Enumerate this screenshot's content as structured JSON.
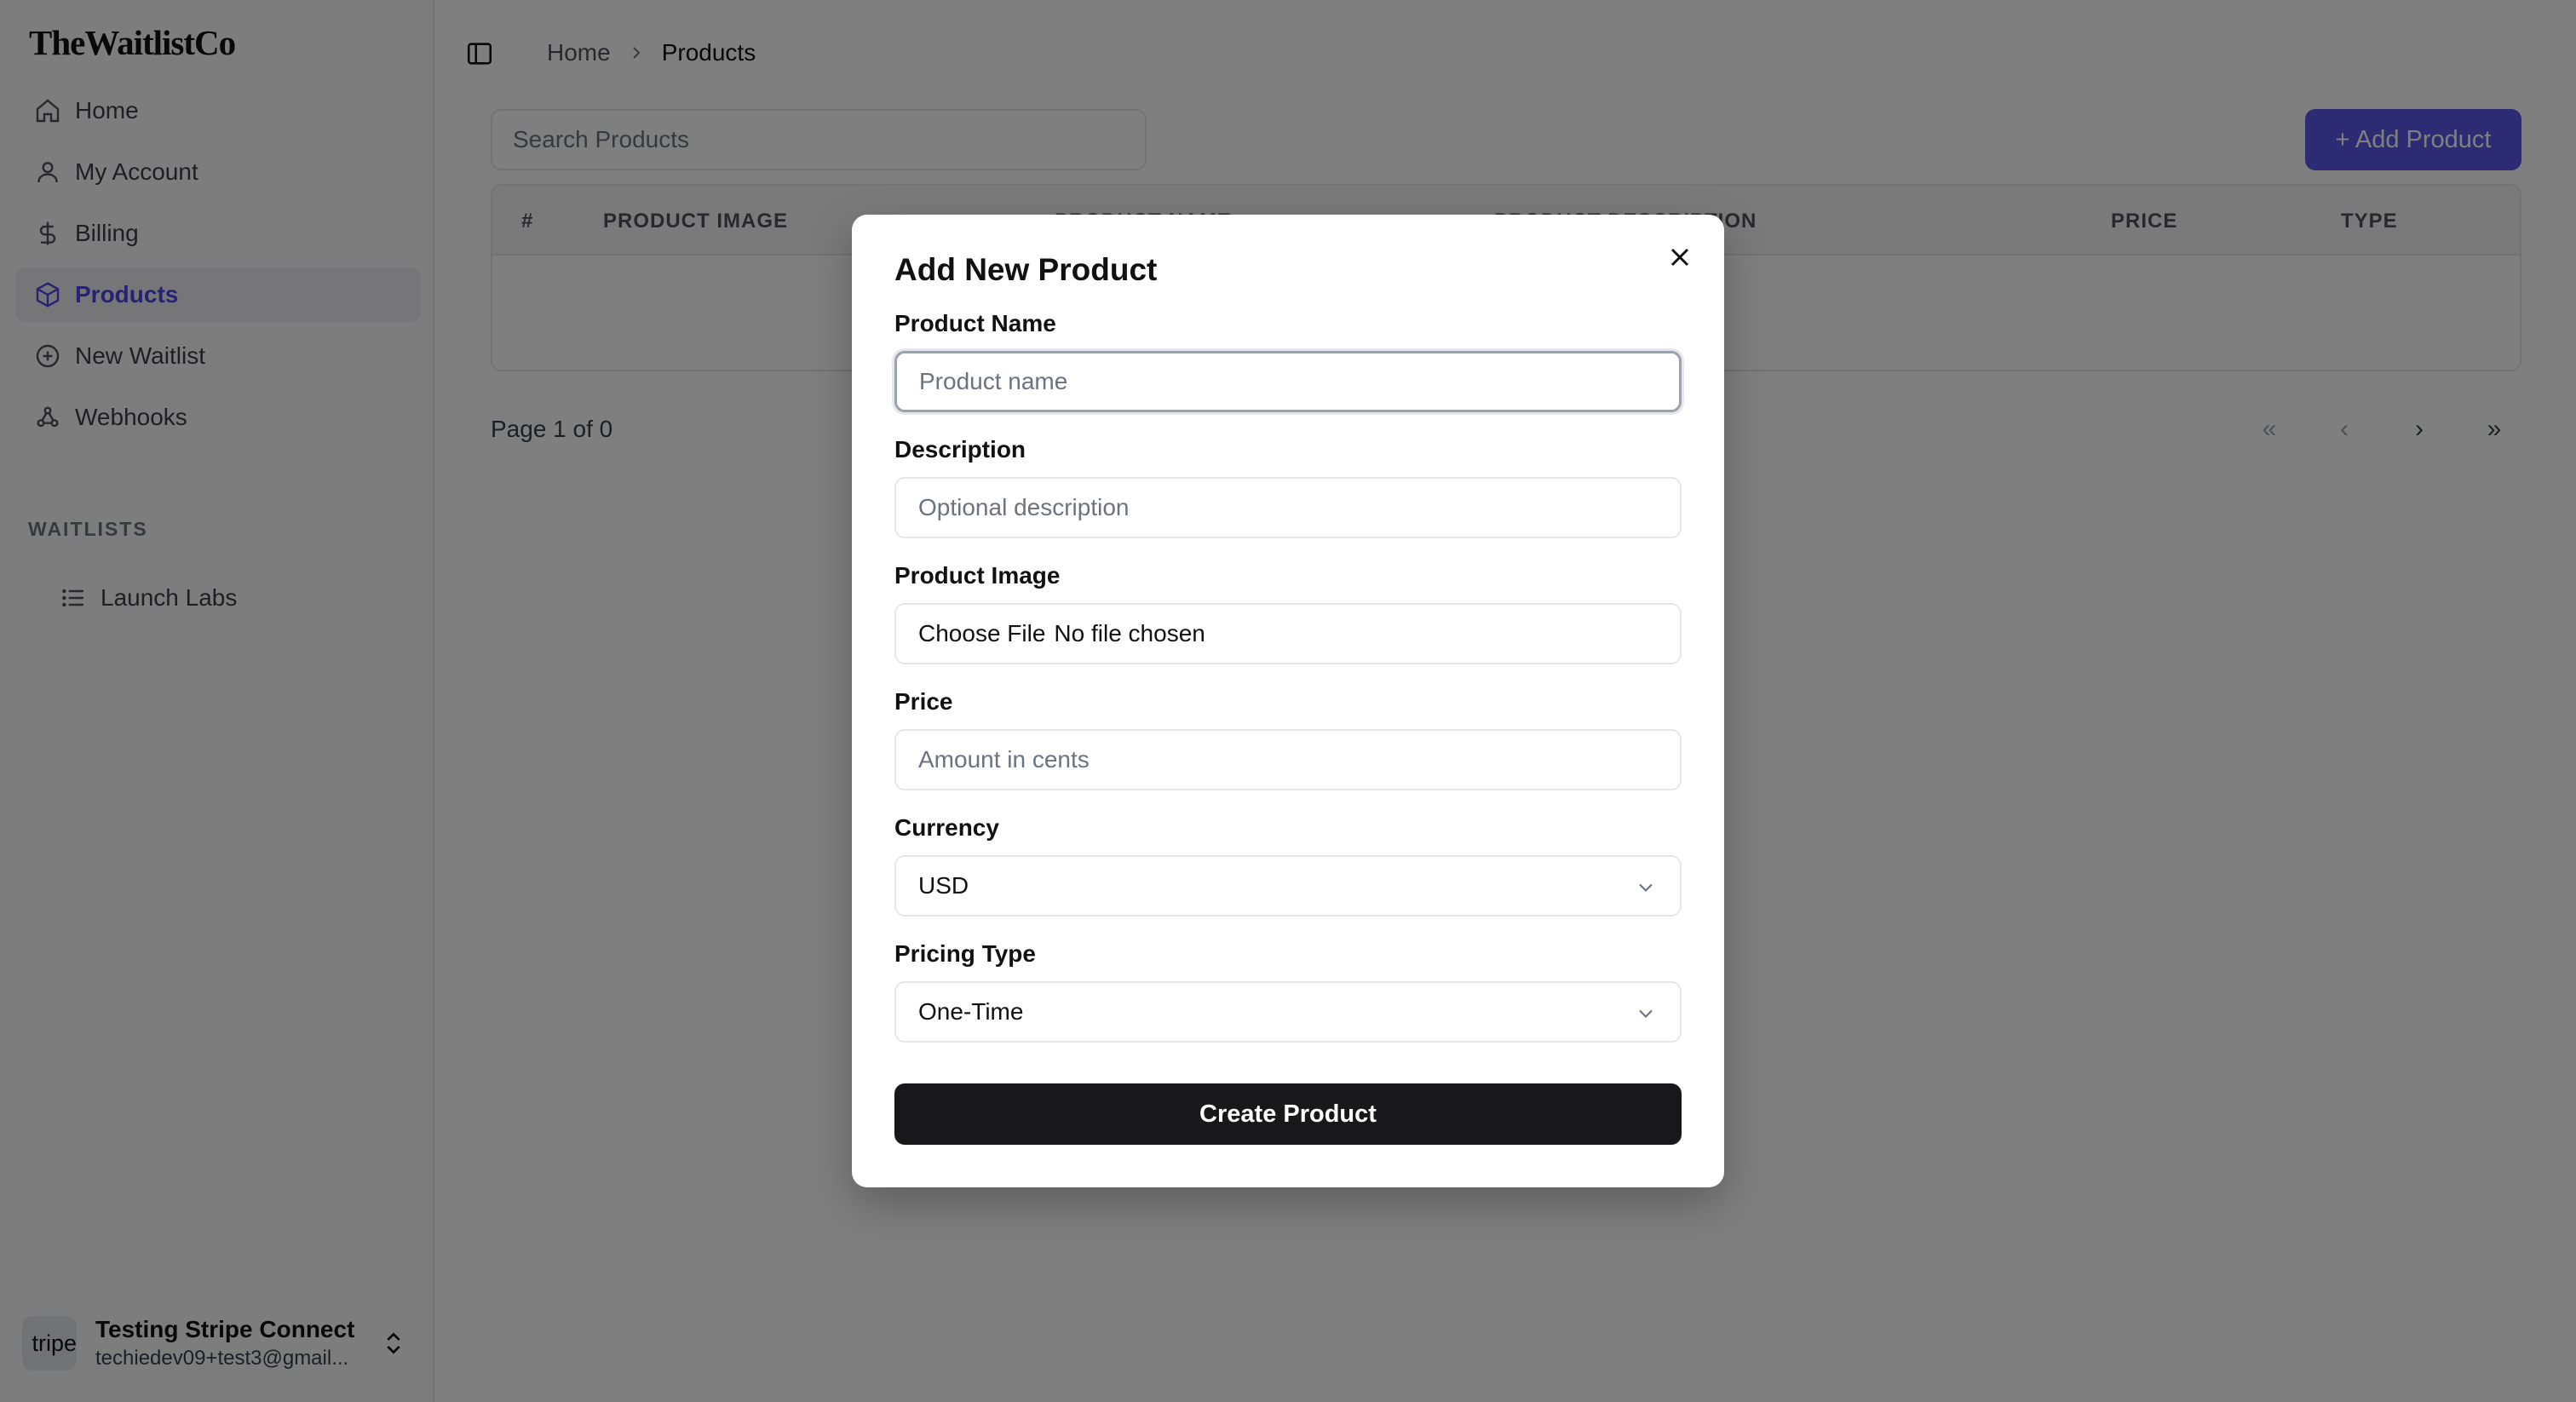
{
  "brand": "TheWaitlistCo",
  "sidebar": {
    "items": [
      {
        "label": "Home"
      },
      {
        "label": "My Account"
      },
      {
        "label": "Billing"
      },
      {
        "label": "Products"
      },
      {
        "label": "New Waitlist"
      },
      {
        "label": "Webhooks"
      }
    ],
    "section_label": "WAITLISTS",
    "waitlists": [
      {
        "label": "Launch Labs"
      }
    ],
    "account": {
      "avatar_text": "tripe",
      "name": "Testing Stripe Connect",
      "email": "techiedev09+test3@gmail..."
    }
  },
  "breadcrumb": {
    "home": "Home",
    "current": "Products"
  },
  "search": {
    "placeholder": "Search Products"
  },
  "add_button": "+ Add Product",
  "table": {
    "columns": [
      "#",
      "PRODUCT IMAGE",
      "PRODUCT NAME",
      "PRODUCT DESCRIPTION",
      "PRICE",
      "TYPE"
    ]
  },
  "pagination": {
    "info": "Page 1 of 0",
    "first": "«",
    "prev": "‹",
    "next": "›",
    "last": "»"
  },
  "modal": {
    "title": "Add New Product",
    "fields": {
      "name": {
        "label": "Product Name",
        "placeholder": "Product name"
      },
      "description": {
        "label": "Description",
        "placeholder": "Optional description"
      },
      "image": {
        "label": "Product Image",
        "button": "Choose File",
        "status": "No file chosen"
      },
      "price": {
        "label": "Price",
        "placeholder": "Amount in cents"
      },
      "currency": {
        "label": "Currency",
        "value": "USD"
      },
      "pricing_type": {
        "label": "Pricing Type",
        "value": "One-Time"
      }
    },
    "submit": "Create Product"
  },
  "colors": {
    "accent": "#5b57e6",
    "primary_button": "#18181b",
    "overlay": "rgba(0,0,0,0.5)"
  }
}
